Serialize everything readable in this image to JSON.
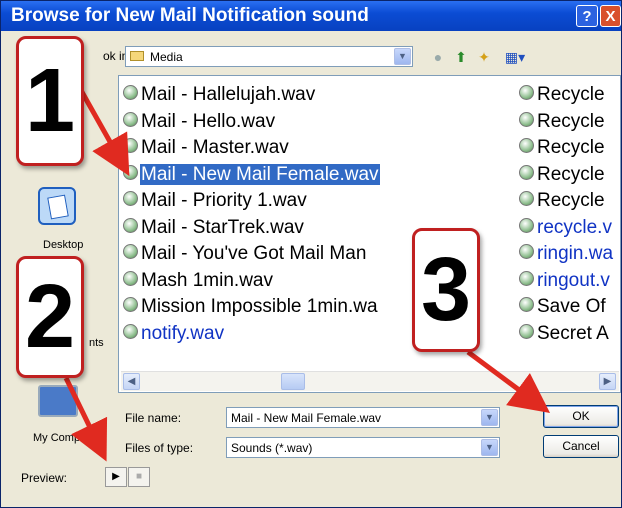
{
  "window": {
    "title": "Browse for New Mail Notification sound",
    "help_btn": "?",
    "close_btn": "X"
  },
  "lookin": {
    "label": "ok in:",
    "value": "Media"
  },
  "places": {
    "desktop": "Desktop",
    "documents": "nts",
    "computer": "My Compu"
  },
  "files_col1": [
    {
      "name": "Mail - Hallelujah.wav"
    },
    {
      "name": "Mail - Hello.wav"
    },
    {
      "name": "Mail - Master.wav"
    },
    {
      "name": "Mail - New Mail Female.wav",
      "selected": true
    },
    {
      "name": "Mail - Priority 1.wav"
    },
    {
      "name": "Mail - StarTrek.wav"
    },
    {
      "name": "Mail - You've Got Mail Man"
    },
    {
      "name": "Mash 1min.wav"
    },
    {
      "name": "Mission Impossible 1min.wa"
    },
    {
      "name": "notify.wav",
      "blue": true
    }
  ],
  "files_col2": [
    {
      "name": "Recycle"
    },
    {
      "name": "Recycle"
    },
    {
      "name": "Recycle"
    },
    {
      "name": "Recycle"
    },
    {
      "name": "Recycle"
    },
    {
      "name": "recycle.v",
      "blue": true
    },
    {
      "name": "ringin.wa",
      "blue": true
    },
    {
      "name": "ringout.v",
      "blue": true
    },
    {
      "name": "Save Of"
    },
    {
      "name": "Secret A"
    }
  ],
  "filename": {
    "label": "File name:",
    "value": "Mail - New Mail Female.wav"
  },
  "filetype": {
    "label": "Files of type:",
    "value": "Sounds (*.wav)"
  },
  "buttons": {
    "ok": "OK",
    "cancel": "Cancel"
  },
  "preview": {
    "label": "Preview:",
    "play": "▶",
    "stop": "■"
  },
  "callouts": {
    "one": "1",
    "two": "2",
    "three": "3"
  },
  "colors": {
    "title_bar": "#0b4cd4",
    "selection": "#316ac5",
    "callout_border": "#c02020",
    "arrow": "#e02a20"
  }
}
